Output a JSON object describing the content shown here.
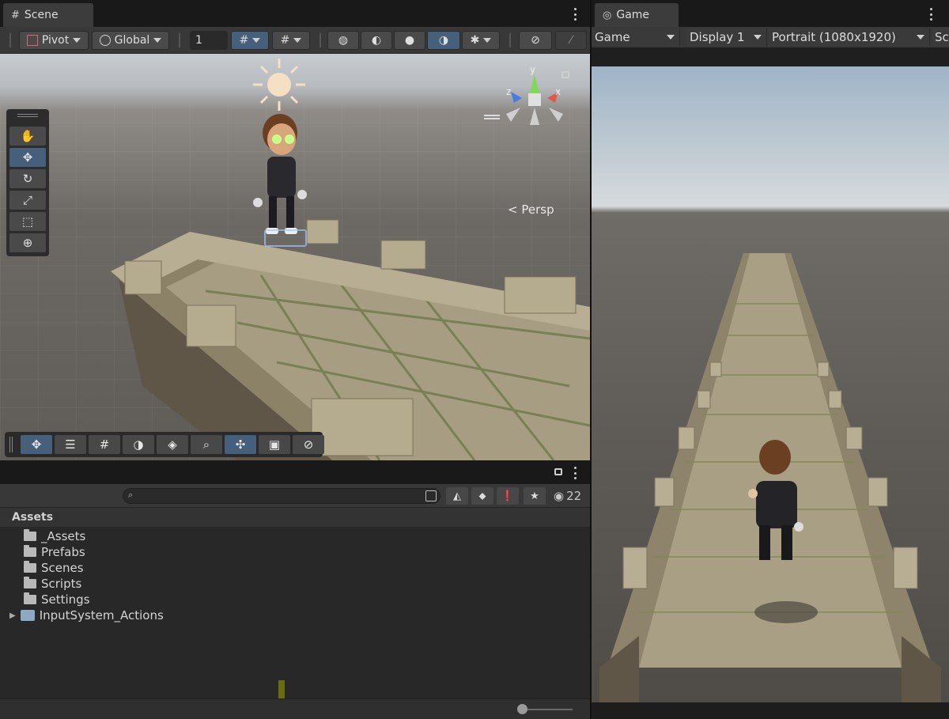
{
  "scene": {
    "tab_label": "Scene",
    "pivot_label": "Pivot",
    "global_label": "Global",
    "grid_snap_value": "1",
    "camera_mode": "Persp",
    "colors": {
      "active_blue": "#46607c",
      "panel": "#383838"
    }
  },
  "game": {
    "tab_label": "Game",
    "view_select": "Game",
    "display_select": "Display 1",
    "resolution_select": "Portrait (1080x1920)",
    "extra_label": "Sc"
  },
  "project": {
    "visibility_count": "22",
    "assets_header": "Assets",
    "items": [
      {
        "label": "_Assets",
        "icon": "folder-icon"
      },
      {
        "label": "Prefabs",
        "icon": "folder-icon"
      },
      {
        "label": "Scenes",
        "icon": "folder-icon"
      },
      {
        "label": "Scripts",
        "icon": "folder-icon"
      },
      {
        "label": "Settings",
        "icon": "folder-icon"
      },
      {
        "label": "InputSystem_Actions",
        "icon": "input-actions-icon"
      }
    ]
  }
}
